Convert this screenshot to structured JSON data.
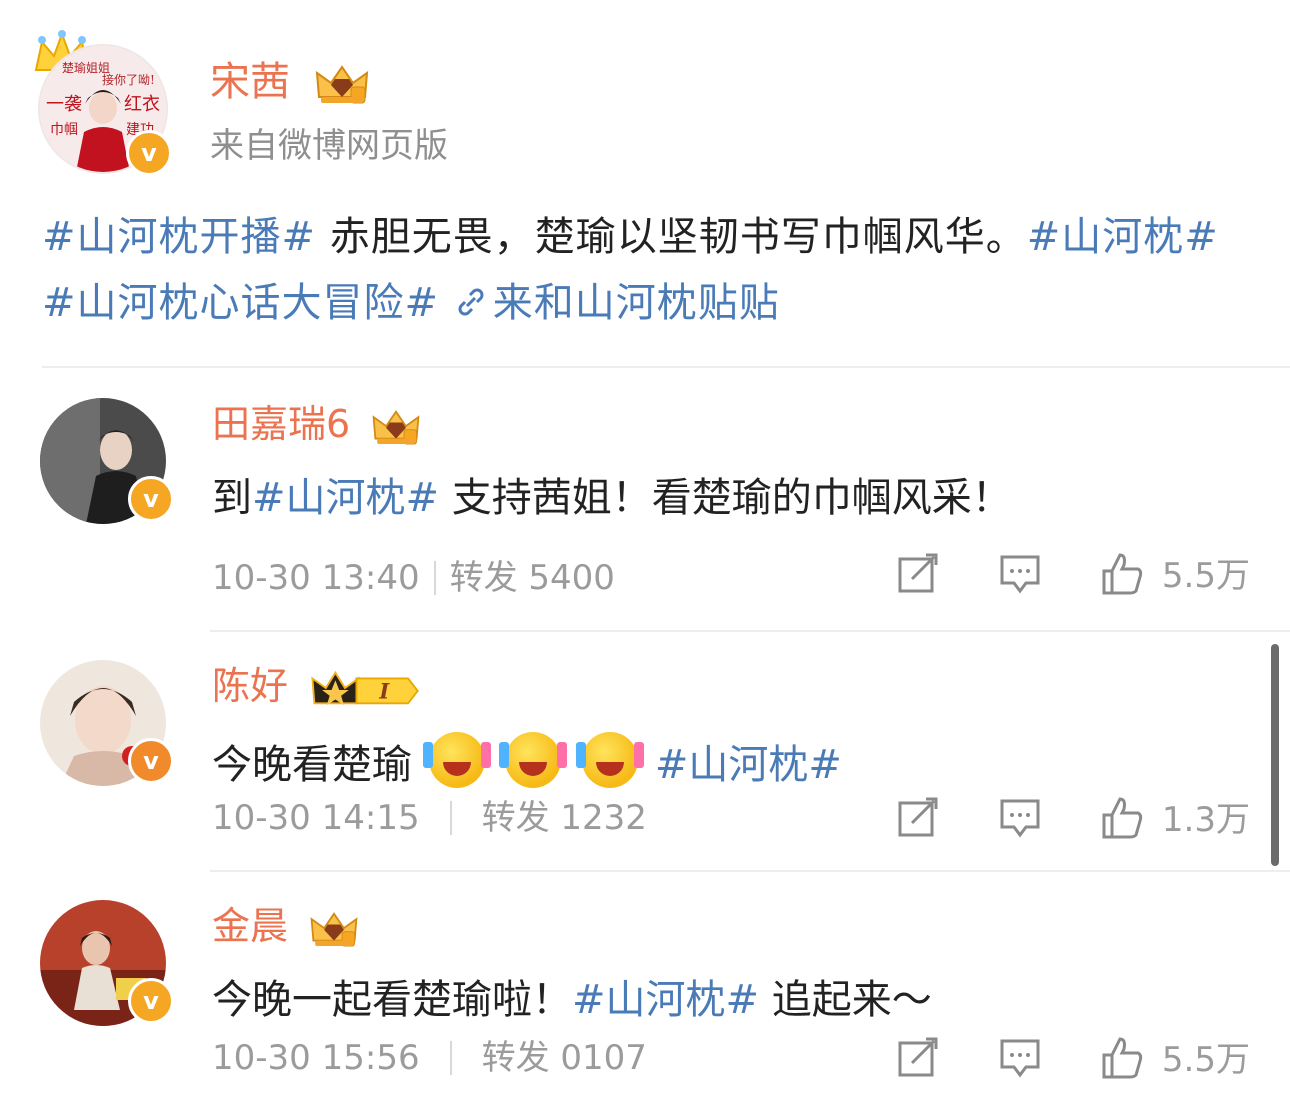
{
  "post": {
    "author": "宋茜",
    "source": "来自微博网页版",
    "avatar_text": {
      "line1": "楚瑜姐姐",
      "line2": "接你了呦!",
      "line3a": "一袭",
      "line3b": "红衣",
      "line4a": "巾帼",
      "line4b": "建功"
    },
    "body": {
      "topic1": "#山河枕开播#",
      "text1": " 赤胆无畏，楚瑜以坚韧书写巾帼风华。",
      "topic2": "#山河枕#",
      "topic3": "#山河枕心话大冒险#",
      "link_text": "来和山河枕贴贴"
    }
  },
  "comments": [
    {
      "name": "田嘉瑞6",
      "text_before": "到",
      "topic": "#山河枕#",
      "text_after": " 支持茜姐！看楚瑜的巾帼风采！",
      "time": "10-30 13:40",
      "repost_label": "转发",
      "repost_count": "5400",
      "likes": "5.5万"
    },
    {
      "name": "陈好",
      "text_before": "今晚看楚瑜",
      "topic": "#山河枕#",
      "text_after": "",
      "time": "10-30 14:15",
      "repost_label": "转发",
      "repost_count": "1232",
      "likes": "1.3万",
      "level_badge": "I"
    },
    {
      "name": "金晨",
      "text_before": "今晚一起看楚瑜啦！",
      "topic": "#山河枕#",
      "text_after": " 追起来～",
      "time": "10-30 15:56",
      "repost_label": "转发",
      "repost_count": "0107",
      "likes": "5.5万"
    }
  ],
  "colors": {
    "name": "#eb7350",
    "topic": "#4a7bb7",
    "meta": "#9b9b9b",
    "verified": "#f5a623"
  }
}
